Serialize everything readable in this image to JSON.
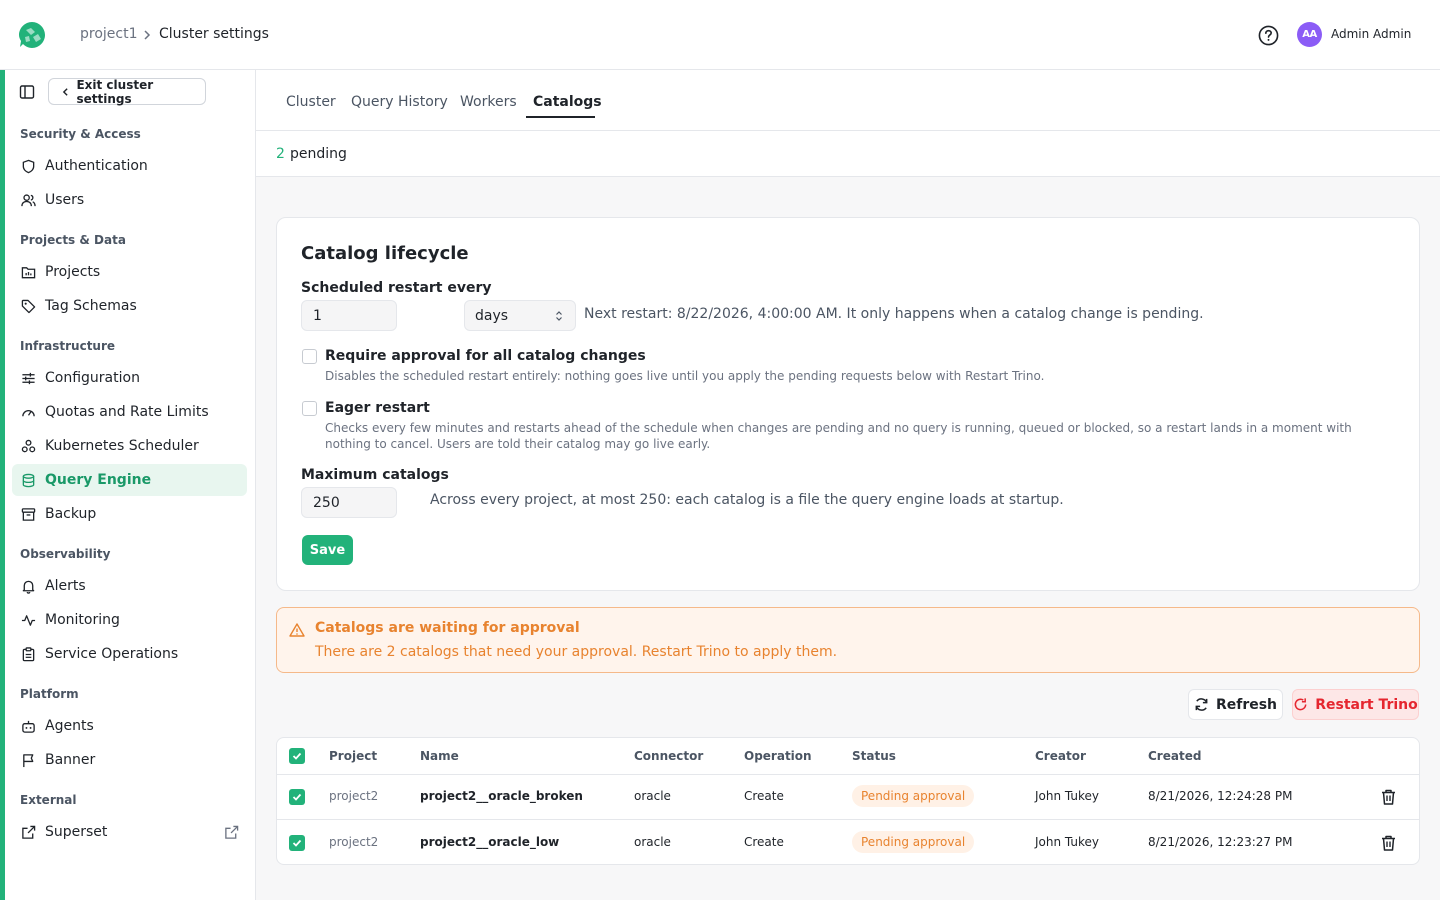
{
  "header": {
    "breadcrumb_project": "project1",
    "breadcrumb_current": "Cluster settings",
    "user_initials": "AA",
    "user_name": "Admin Admin"
  },
  "sidebar": {
    "exit_label": "Exit cluster settings",
    "sections": {
      "security": "Security & Access",
      "projects": "Projects & Data",
      "infrastructure": "Infrastructure",
      "observability": "Observability",
      "platform": "Platform",
      "external": "External"
    },
    "items": {
      "authentication": "Authentication",
      "users": "Users",
      "projects": "Projects",
      "tag_schemas": "Tag Schemas",
      "configuration": "Configuration",
      "quotas": "Quotas and Rate Limits",
      "kubernetes": "Kubernetes Scheduler",
      "query_engine": "Query Engine",
      "backup": "Backup",
      "alerts": "Alerts",
      "monitoring": "Monitoring",
      "service_operations": "Service Operations",
      "agents": "Agents",
      "banner": "Banner",
      "superset": "Superset"
    }
  },
  "tabs": {
    "cluster": "Cluster",
    "query_history": "Query History",
    "workers": "Workers",
    "catalogs": "Catalogs"
  },
  "pending": {
    "count": "2",
    "label": "pending"
  },
  "lifecycle": {
    "title": "Catalog lifecycle",
    "restart_label": "Scheduled restart every",
    "restart_value": "1",
    "restart_unit": "days",
    "next_restart_text": "Next restart: 8/22/2026, 4:00:00 AM. It only happens when a catalog change is pending.",
    "approval_title": "Require approval for all catalog changes",
    "approval_desc": "Disables the scheduled restart entirely: nothing goes live until you apply the pending requests below with Restart Trino.",
    "eager_title": "Eager restart",
    "eager_desc": "Checks every few minutes and restarts ahead of the schedule when changes are pending and no query is running, queued or blocked, so a restart lands in a moment with nothing to cancel. Users are told their catalog may go live early.",
    "max_label": "Maximum catalogs",
    "max_value": "250",
    "max_hint": "Across every project, at most 250: each catalog is a file the query engine loads at startup.",
    "save_label": "Save"
  },
  "alert": {
    "title": "Catalogs are waiting for approval",
    "text": "There are 2 catalogs that need your approval. Restart Trino to apply them."
  },
  "actions": {
    "refresh_label": "Refresh",
    "restart_label": "Restart Trino"
  },
  "table": {
    "headers": {
      "project": "Project",
      "name": "Name",
      "connector": "Connector",
      "operation": "Operation",
      "status": "Status",
      "creator": "Creator",
      "created": "Created"
    },
    "rows": [
      {
        "project": "project2",
        "name": "project2__oracle_broken",
        "connector": "oracle",
        "operation": "Create",
        "status": "Pending approval",
        "creator": "John Tukey",
        "created": "8/21/2026, 12:24:28 PM"
      },
      {
        "project": "project2",
        "name": "project2__oracle_low",
        "connector": "oracle",
        "operation": "Create",
        "status": "Pending approval",
        "creator": "John Tukey",
        "created": "8/21/2026, 12:23:27 PM"
      }
    ]
  },
  "colors": {
    "accent": "#22b27a",
    "warning": "#e8832f",
    "danger": "#e5262f"
  }
}
